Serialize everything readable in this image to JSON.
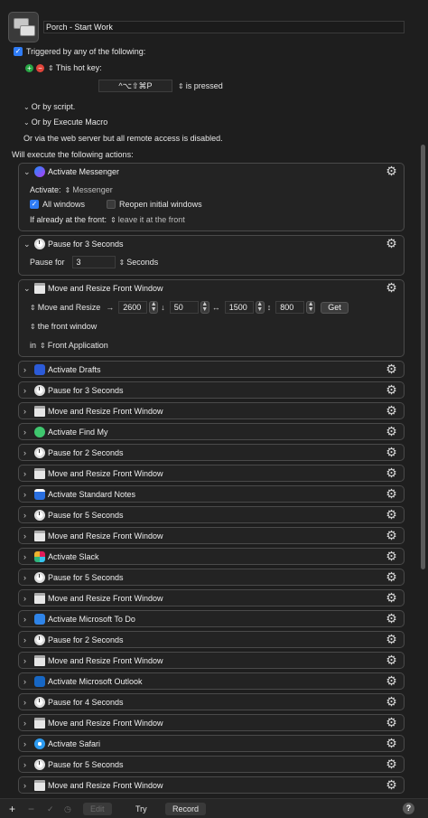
{
  "macro": {
    "name": "Porch - Start Work"
  },
  "trigger": {
    "triggered_label": "Triggered by any of the following:",
    "hotkey_label": "This hot key:",
    "hotkey_value": "^⌥⇧⌘P",
    "hotkey_condition": "is pressed",
    "or_by_script": "Or by script.",
    "or_by_execute_macro": "Or by Execute Macro",
    "web_server_note": "Or via the web server but all remote access is disabled.",
    "will_execute": "Will execute the following actions:"
  },
  "activate_messenger": {
    "title": "Activate Messenger",
    "activate_label": "Activate:",
    "app": "Messenger",
    "all_windows": "All windows",
    "reopen": "Reopen initial windows",
    "if_already_label": "If already at the front:",
    "if_already_value": "leave it at the front"
  },
  "pause_3": {
    "title": "Pause for 3 Seconds",
    "pause_label": "Pause for",
    "value": "3",
    "unit": "Seconds"
  },
  "move_resize": {
    "title": "Move and Resize Front Window",
    "mode": "Move and Resize",
    "x": "2600",
    "y": "50",
    "w": "1500",
    "h": "800",
    "get": "Get",
    "target": "the front window",
    "in_label": "in",
    "in_value": "Front Application"
  },
  "collapsed_actions": [
    {
      "title": "Activate Drafts",
      "icon": "drafts-icon"
    },
    {
      "title": "Pause for 3 Seconds",
      "icon": "clock-icon"
    },
    {
      "title": "Move and Resize Front Window",
      "icon": "window-icon"
    },
    {
      "title": "Activate Find My",
      "icon": "findmy-icon"
    },
    {
      "title": "Pause for 2 Seconds",
      "icon": "clock-icon"
    },
    {
      "title": "Move and Resize Front Window",
      "icon": "window-icon"
    },
    {
      "title": "Activate Standard Notes",
      "icon": "notes-icon"
    },
    {
      "title": "Pause for 5 Seconds",
      "icon": "clock-icon"
    },
    {
      "title": "Move and Resize Front Window",
      "icon": "window-icon"
    },
    {
      "title": "Activate Slack",
      "icon": "slack-icon"
    },
    {
      "title": "Pause for 5 Seconds",
      "icon": "clock-icon"
    },
    {
      "title": "Move and Resize Front Window",
      "icon": "window-icon"
    },
    {
      "title": "Activate Microsoft To Do",
      "icon": "todo-icon"
    },
    {
      "title": "Pause for 2 Seconds",
      "icon": "clock-icon"
    },
    {
      "title": "Move and Resize Front Window",
      "icon": "window-icon"
    },
    {
      "title": "Activate Microsoft Outlook",
      "icon": "outlook-icon"
    },
    {
      "title": "Pause for 4 Seconds",
      "icon": "clock-icon"
    },
    {
      "title": "Move and Resize Front Window",
      "icon": "window-icon"
    },
    {
      "title": "Activate Safari",
      "icon": "safari-icon"
    },
    {
      "title": "Pause for 5 Seconds",
      "icon": "clock-icon"
    },
    {
      "title": "Move and Resize Front Window",
      "icon": "window-icon"
    }
  ],
  "bottom": {
    "add": "+",
    "remove": "−",
    "edit": "Edit",
    "try": "Try",
    "record": "Record",
    "help": "?"
  },
  "colors": {
    "accent": "#2f7cf6",
    "background": "#1e1e1e",
    "panel": "#232323"
  }
}
